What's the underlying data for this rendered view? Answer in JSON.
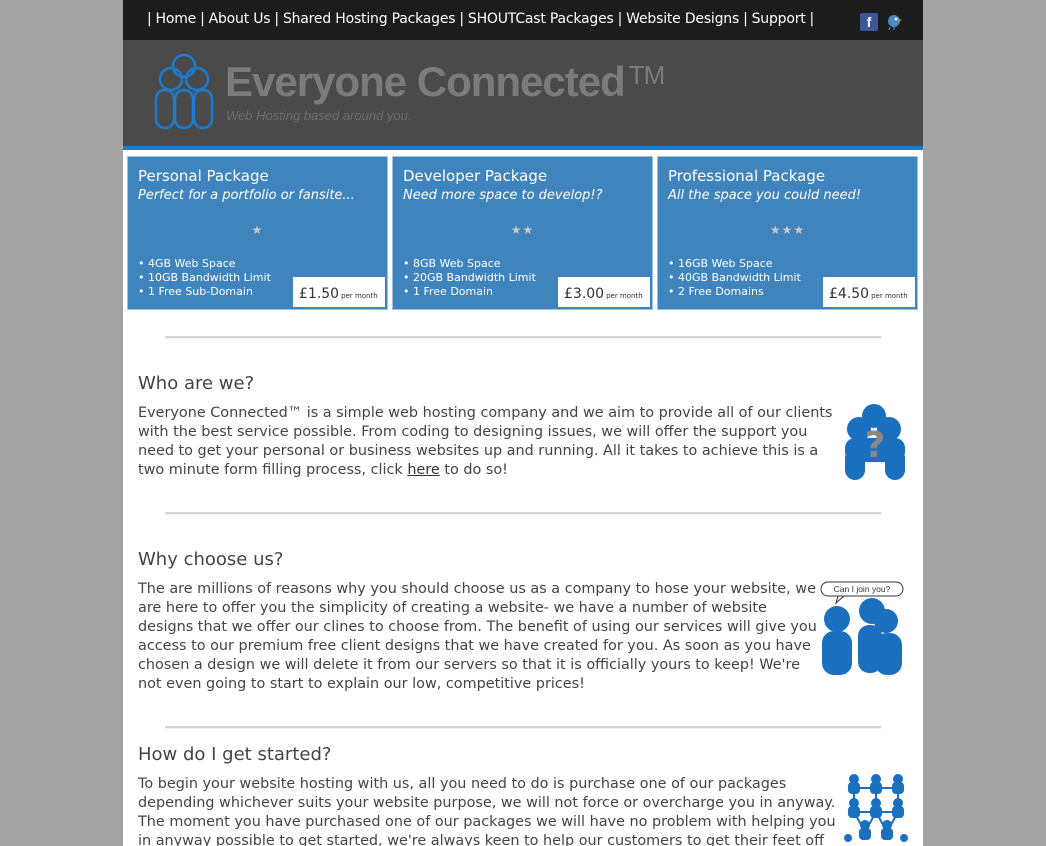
{
  "nav": {
    "items": [
      "Home",
      "About Us",
      "Shared Hosting Packages",
      "SHOUTCast Packages",
      "Website Designs",
      "Support"
    ],
    "separator": "|",
    "facebook_label": "f",
    "facebook_icon": "facebook-icon",
    "twitter_icon": "twitter-bird-icon"
  },
  "header": {
    "logo_icon": "people-group-logo-icon",
    "site_name": "Everyone Connected",
    "trademark": "TM",
    "tagline": "Web Hosting based around you."
  },
  "packages": [
    {
      "title": "Personal Package",
      "subtitle": "Perfect for a portfolio or fansite...",
      "stars": "★",
      "star_rating": 1,
      "features": [
        "• 4GB Web Space",
        "• 10GB Bandwidth Limit",
        "• 1 Free Sub-Domain"
      ],
      "price": "£1.50",
      "per": "per month"
    },
    {
      "title": "Developer Package",
      "subtitle": "Need more space to develop!?",
      "stars": "★★",
      "star_rating": 2,
      "features": [
        "• 8GB Web Space",
        "• 20GB Bandwidth Limit",
        "• 1 Free Domain"
      ],
      "price": "£3.00",
      "per": "per month"
    },
    {
      "title": "Professional Package",
      "subtitle": "All the space you could need!",
      "stars": "★★★",
      "star_rating": 3,
      "features": [
        "• 16GB Web Space",
        "• 40GB Bandwidth Limit",
        "• 2 Free Domains"
      ],
      "price": "£4.50",
      "per": "per month"
    }
  ],
  "sections": {
    "who": {
      "title": "Who are we?",
      "text_before_link": "Everyone Connected™ is a simple web hosting company and we aim to provide all of our clients with the best service possible. From coding to designing issues, we will offer the support you need to get your personal or business websites up and running. All it takes to achieve this is a two minute form filling process, click ",
      "link": "here",
      "text_after_link": " to do so!",
      "icon": "question-person-icon",
      "icon_glyph": "?"
    },
    "why": {
      "title": "Why choose us?",
      "text": "The are millions of reasons why you should choose us as a company to hose your website, we are here to offer you the simplicity of creating a website- we have a number of website designs that we offer our clines to choose from. The benefit of using our services will give you access to our premium free client designs that we have created for you. As soon as you have chosen a design we will delete it from our servers so that it is officially yours to keep! We're not even going to start to explain our low, competitive prices!",
      "icon": "people-speech-bubble-icon",
      "bubble_text": "Can I join you?"
    },
    "start": {
      "title": "How do I get started?",
      "text": "To begin your website hosting with us, all you need to do is purchase one of our packages depending whichever suits your website purpose, we will not force or overcharge you in anyway. The moment you have purchased one of our packages we will have no problem with helping you in anyway possible to get started, we're always keen to help our customers to get their feet off the",
      "icon": "people-network-icon"
    }
  },
  "colors": {
    "accent_blue": "#3f84bd",
    "header_bg": "#4a4a4a",
    "nav_bg": "#1c1c1c",
    "page_bg": "#a3a3a3",
    "logo_blue": "#1d7bcf"
  }
}
